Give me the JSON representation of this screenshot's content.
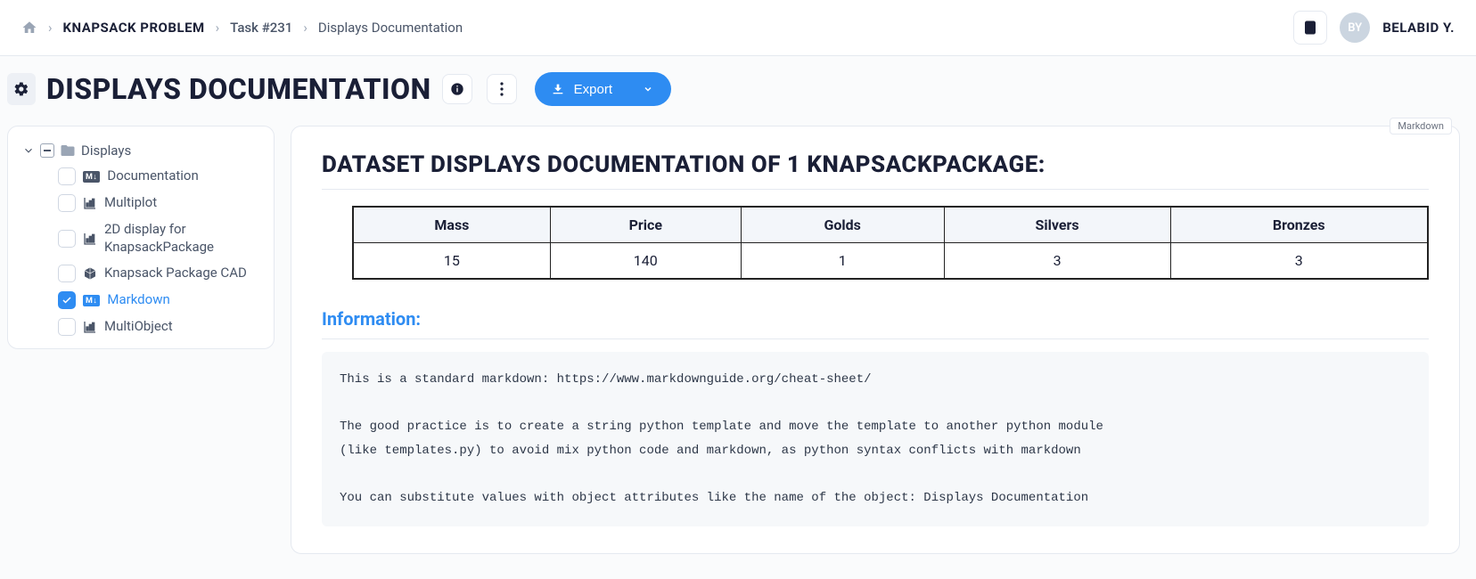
{
  "breadcrumb": {
    "project": "KNAPSACK PROBLEM",
    "task": "Task #231",
    "current": "Displays Documentation"
  },
  "user": {
    "initials": "BY",
    "name": "BELABID Y."
  },
  "page": {
    "title": "DISPLAYS DOCUMENTATION"
  },
  "toolbar": {
    "export_label": "Export"
  },
  "sidebar": {
    "root_label": "Displays",
    "items": [
      {
        "label": "Documentation",
        "type_badge": "M↓",
        "icon": "markdown",
        "checked": false
      },
      {
        "label": "Multiplot",
        "icon": "chart",
        "checked": false
      },
      {
        "label": "2D display for KnapsackPackage",
        "icon": "chart",
        "checked": false
      },
      {
        "label": "Knapsack Package CAD",
        "icon": "cube",
        "checked": false
      },
      {
        "label": "Markdown",
        "type_badge": "M↓",
        "icon": "markdown",
        "checked": true
      },
      {
        "label": "MultiObject",
        "icon": "chart",
        "checked": false
      }
    ]
  },
  "main": {
    "tag": "Markdown",
    "dataset_title": "DATASET DISPLAYS DOCUMENTATION OF 1 KNAPSACKPACKAGE:",
    "table": {
      "headers": [
        "Mass",
        "Price",
        "Golds",
        "Silvers",
        "Bronzes"
      ],
      "row": [
        "15",
        "140",
        "1",
        "3",
        "3"
      ]
    },
    "section_title": "Information:",
    "info_text": "This is a standard markdown: https://www.markdownguide.org/cheat-sheet/\n\nThe good practice is to create a string python template and move the template to another python module\n(like templates.py) to avoid mix python code and markdown, as python syntax conflicts with markdown\n\nYou can substitute values with object attributes like the name of the object: Displays Documentation"
  }
}
